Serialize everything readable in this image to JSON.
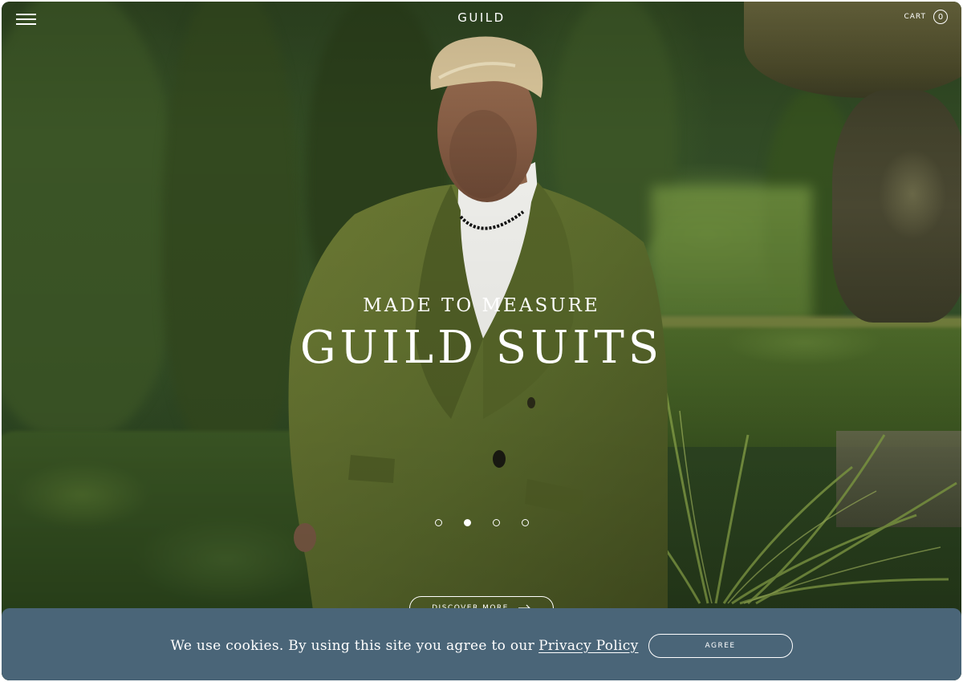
{
  "header": {
    "logo": "GUILD",
    "menu_icon": "hamburger-menu-icon",
    "cart_label": "CART",
    "cart_count": "0"
  },
  "hero": {
    "subtitle": "MADE TO MEASURE",
    "title": "GUILD SUITS",
    "slides_total": 4,
    "active_slide": 2,
    "cta_label": "DISCOVER MORE",
    "cta_icon": "arrow-right-icon"
  },
  "cookie_banner": {
    "text": "We use cookies. By using this site you agree to our",
    "link_label": "Privacy Policy",
    "agree_label": "AGREE",
    "background": "#4a6578"
  },
  "colors": {
    "text": "#ffffff",
    "suit": "#5a6a2c"
  }
}
